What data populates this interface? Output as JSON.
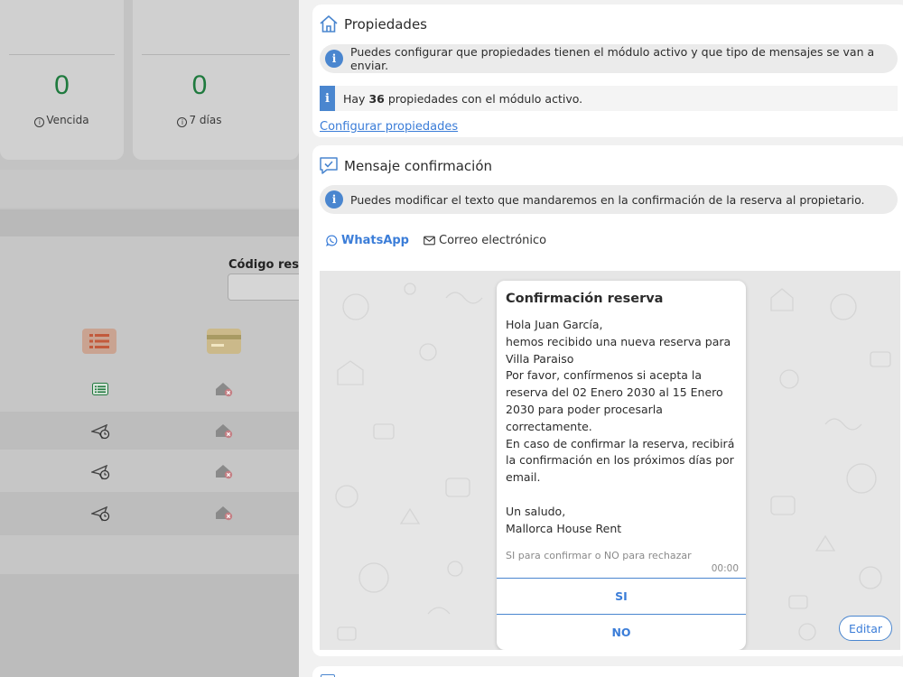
{
  "background": {
    "stats": [
      {
        "value": "0",
        "label": "Vencida"
      },
      {
        "value": "0",
        "label": "7 días"
      }
    ],
    "codigo_label": "Código rese"
  },
  "propiedades": {
    "title": "Propiedades",
    "info": "Puedes configurar que propiedades tienen el módulo activo y que tipo de mensajes se van a enviar.",
    "count_prefix": "Hay",
    "count_value": "36",
    "count_suffix": "propiedades con el módulo activo.",
    "link": "Configurar propiedades"
  },
  "mensaje": {
    "title": "Mensaje confirmación",
    "info": "Puedes modificar el texto que mandaremos en la confirmación de la reserva al propietario.",
    "tabs": [
      {
        "label": "WhatsApp",
        "icon": "whatsapp-icon",
        "active": true
      },
      {
        "label": "Correo electrónico",
        "icon": "mail-icon",
        "active": false
      }
    ],
    "preview": {
      "title": "Confirmación reserva",
      "lines": [
        "Hola Juan García,",
        "hemos recibido una nueva reserva para Villa Paraiso",
        "Por favor, confírmenos si acepta la reserva del 02 Enero 2030 al 15 Enero 2030 para poder procesarla correctamente.",
        "En caso de confirmar la reserva, recibirá la confirmación en los próximos días por email.",
        "",
        "Un saludo,",
        "Mallorca House Rent"
      ],
      "footer": "SI para confirmar o NO para rechazar",
      "time": "00:00",
      "buttons": [
        "SI",
        "NO"
      ]
    },
    "edit_label": "Editar"
  },
  "colors": {
    "accent": "#4a86cf",
    "link": "#3b7dd8",
    "stat_green": "#1f7a3e",
    "overlay": "#c3c3c3"
  }
}
